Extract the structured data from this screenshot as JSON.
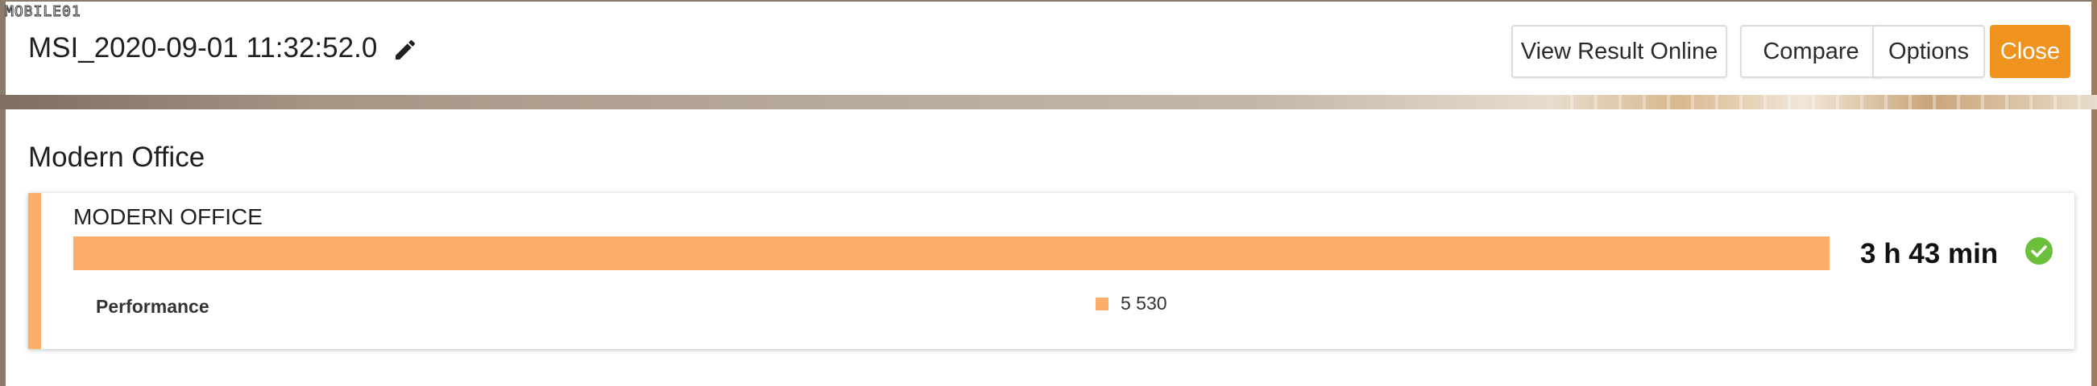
{
  "watermark": "MOBILE01",
  "header": {
    "title": "MSI_2020-09-01 11:32:52.0",
    "edit_icon": "pencil-icon",
    "buttons": {
      "view_result_online": "View Result Online",
      "compare": "Compare",
      "options": "Options",
      "close": "Close"
    }
  },
  "section": {
    "title": "Modern Office"
  },
  "card": {
    "title": "MODERN OFFICE",
    "bar_fill_fraction": 1.0,
    "score": "3 h 43 min",
    "status_icon": "check-circle-icon",
    "metric": {
      "label": "Performance",
      "value": "5 530"
    }
  },
  "colors": {
    "accent_orange": "#f0921e",
    "bar_orange": "#fbae6a",
    "success_green": "#6cbf3a"
  }
}
